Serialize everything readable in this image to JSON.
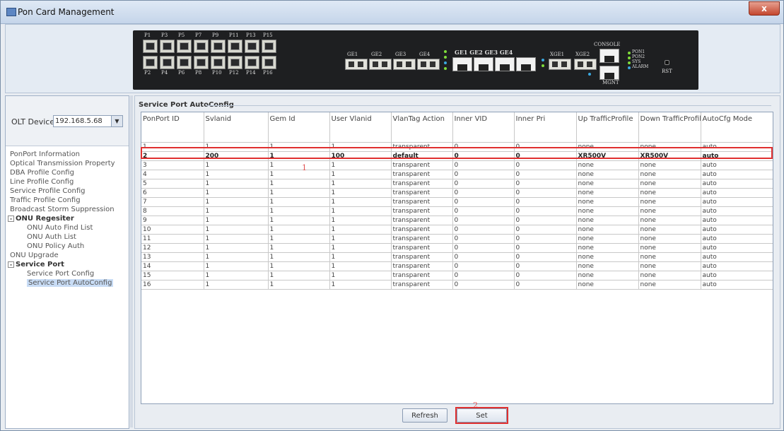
{
  "window": {
    "title": "Pon Card Management",
    "close_glyph": "x"
  },
  "device": {
    "pon_top_labels": [
      "P1",
      "P3",
      "P5",
      "P7",
      "P9",
      "P11",
      "P13",
      "P15"
    ],
    "pon_bottom_labels": [
      "P2",
      "P4",
      "P6",
      "P8",
      "P10",
      "P12",
      "P14",
      "P16"
    ],
    "ge_sfp_labels": [
      "GE1",
      "GE2",
      "GE3",
      "GE4"
    ],
    "ge_rj_labels": "GE1 GE2 GE3 GE4",
    "xge_labels": [
      "XGE1",
      "XGE2"
    ],
    "console_label": "CONSOLE",
    "mgnt_label": "MGNT",
    "status_leds": [
      "PON1",
      "PON2",
      "SYS",
      "ALARM"
    ],
    "rst_label": "RST"
  },
  "olt": {
    "label": "OLT Device",
    "value": "192.168.5.68"
  },
  "tree": [
    {
      "label": "PonPort Information",
      "level": 0
    },
    {
      "label": "Optical Transmission Property",
      "level": 0
    },
    {
      "label": "DBA Profile Config",
      "level": 0
    },
    {
      "label": "Line Profile Config",
      "level": 0
    },
    {
      "label": "Service Profile Config",
      "level": 0
    },
    {
      "label": "Traffic Profile Config",
      "level": 0
    },
    {
      "label": "Broadcast Storm Suppression",
      "level": 0
    },
    {
      "label": "ONU Regesiter",
      "level": 0,
      "bold": true,
      "expander": "-"
    },
    {
      "label": "ONU Auto Find List",
      "level": 1
    },
    {
      "label": "ONU Auth List",
      "level": 1
    },
    {
      "label": "ONU Policy Auth",
      "level": 1
    },
    {
      "label": "ONU Upgrade",
      "level": 0
    },
    {
      "label": "Service Port",
      "level": 0,
      "bold": true,
      "expander": "-"
    },
    {
      "label": "Service Port Config",
      "level": 1
    },
    {
      "label": "Service Port AutoConfig",
      "level": 1,
      "selected": true
    }
  ],
  "main": {
    "title": "Service Port AutoConfig",
    "columns": [
      "PonPort ID",
      "Svlanid",
      "Gem Id",
      "User Vlanid",
      "VlanTag Action",
      "Inner VID",
      "Inner Pri",
      "Up TrafficProfile",
      "Down TrafficProfile",
      "AutoCfg Mode"
    ],
    "rows": [
      [
        "1",
        "1",
        "1",
        "1",
        "transparent",
        "0",
        "0",
        "none",
        "none",
        "auto"
      ],
      [
        "2",
        "200",
        "1",
        "100",
        "default",
        "0",
        "0",
        "XR500V",
        "XR500V",
        "auto"
      ],
      [
        "3",
        "1",
        "1",
        "1",
        "transparent",
        "0",
        "0",
        "none",
        "none",
        "auto"
      ],
      [
        "4",
        "1",
        "1",
        "1",
        "transparent",
        "0",
        "0",
        "none",
        "none",
        "auto"
      ],
      [
        "5",
        "1",
        "1",
        "1",
        "transparent",
        "0",
        "0",
        "none",
        "none",
        "auto"
      ],
      [
        "6",
        "1",
        "1",
        "1",
        "transparent",
        "0",
        "0",
        "none",
        "none",
        "auto"
      ],
      [
        "7",
        "1",
        "1",
        "1",
        "transparent",
        "0",
        "0",
        "none",
        "none",
        "auto"
      ],
      [
        "8",
        "1",
        "1",
        "1",
        "transparent",
        "0",
        "0",
        "none",
        "none",
        "auto"
      ],
      [
        "9",
        "1",
        "1",
        "1",
        "transparent",
        "0",
        "0",
        "none",
        "none",
        "auto"
      ],
      [
        "10",
        "1",
        "1",
        "1",
        "transparent",
        "0",
        "0",
        "none",
        "none",
        "auto"
      ],
      [
        "11",
        "1",
        "1",
        "1",
        "transparent",
        "0",
        "0",
        "none",
        "none",
        "auto"
      ],
      [
        "12",
        "1",
        "1",
        "1",
        "transparent",
        "0",
        "0",
        "none",
        "none",
        "auto"
      ],
      [
        "13",
        "1",
        "1",
        "1",
        "transparent",
        "0",
        "0",
        "none",
        "none",
        "auto"
      ],
      [
        "14",
        "1",
        "1",
        "1",
        "transparent",
        "0",
        "0",
        "none",
        "none",
        "auto"
      ],
      [
        "15",
        "1",
        "1",
        "1",
        "transparent",
        "0",
        "0",
        "none",
        "none",
        "auto"
      ],
      [
        "16",
        "1",
        "1",
        "1",
        "transparent",
        "0",
        "0",
        "none",
        "none",
        "auto"
      ]
    ],
    "highlight_row": 1,
    "annotation_1": "1",
    "annotation_2": "2",
    "refresh_label": "Refresh",
    "set_label": "Set"
  },
  "colors": {
    "highlight": "#e03030",
    "annotation": "#e05050"
  }
}
